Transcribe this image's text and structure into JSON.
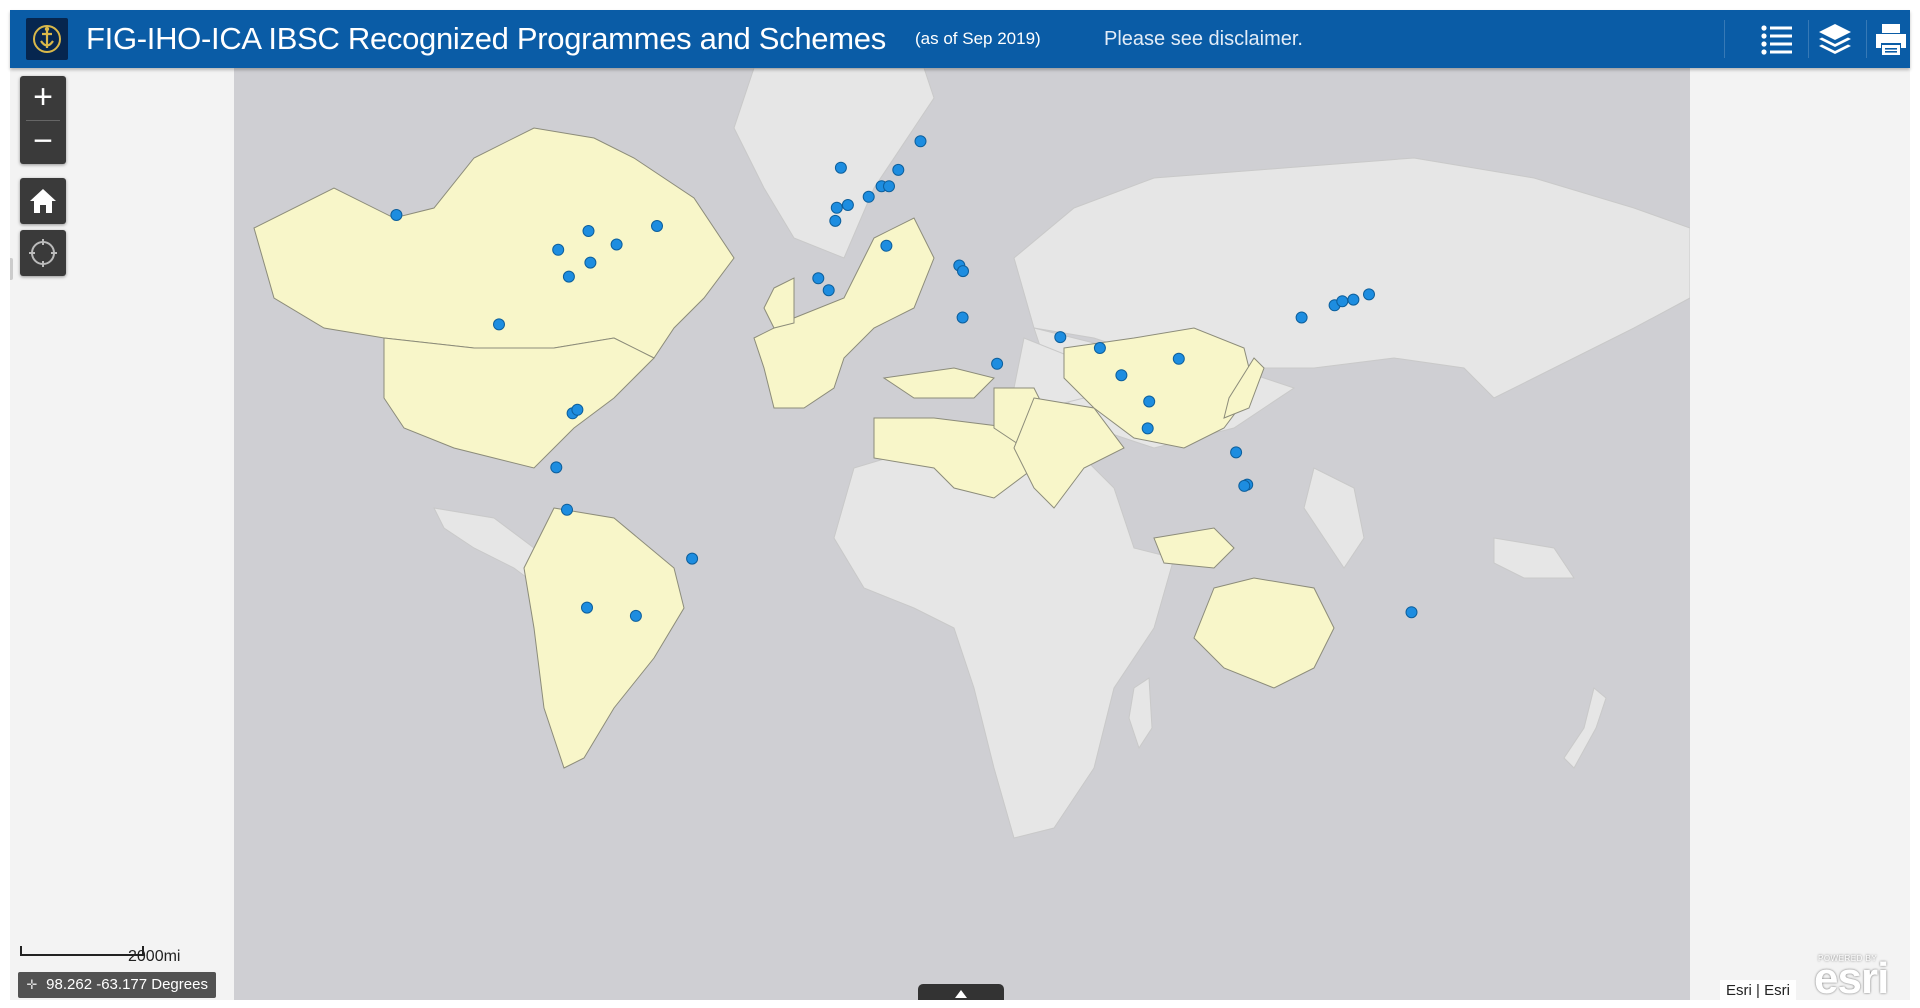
{
  "header": {
    "title": "FIG-IHO-ICA IBSC Recognized Programmes and Schemes",
    "subtitle": "(as of Sep 2019)",
    "disclaimer": "Please see disclaimer.",
    "icons": [
      "logo-emblem-icon",
      "legend-list-icon",
      "layers-icon",
      "print-icon"
    ]
  },
  "map_controls": {
    "zoom_in_label": "+",
    "zoom_out_label": "−",
    "home_icon": "home-icon",
    "locate_icon": "locate-icon"
  },
  "scale": {
    "label": "2000mi"
  },
  "coordinates": {
    "value": "98.262 -63.177 Degrees"
  },
  "attribution": {
    "text": "Esri | Esri"
  },
  "esri_logo": {
    "top": "POWERED BY",
    "word": "esri"
  },
  "colors": {
    "header_bg": "#0a5ca6",
    "ocean": "#cfcfd3",
    "land": "#e6e6e6",
    "highlighted_land": "#f8f6c9",
    "marker": "#1d8de0"
  },
  "map_points": [
    {
      "lon": -123.1,
      "lat": 49.3
    },
    {
      "lon": -79.4,
      "lat": 43.7
    },
    {
      "lon": -71.2,
      "lat": 46.8
    },
    {
      "lon": -63.6,
      "lat": 44.6
    },
    {
      "lon": -52.7,
      "lat": 47.6
    },
    {
      "lon": -76.5,
      "lat": 39.0
    },
    {
      "lon": -95.4,
      "lat": 29.8
    },
    {
      "lon": -70.7,
      "lat": 41.5
    },
    {
      "lon": -75.5,
      "lat": 10.4
    },
    {
      "lon": -74.2,
      "lat": 11.2
    },
    {
      "lon": -79.9,
      "lat": -2.2
    },
    {
      "lon": -77.0,
      "lat": -12.0
    },
    {
      "lon": -43.2,
      "lat": -22.9
    },
    {
      "lon": -71.6,
      "lat": -33.0
    },
    {
      "lon": -58.4,
      "lat": -34.6
    },
    {
      "lon": -3.0,
      "lat": 56.0
    },
    {
      "lon": -1.1,
      "lat": 50.8
    },
    {
      "lon": -4.1,
      "lat": 50.4
    },
    {
      "lon": 4.5,
      "lat": 52.0
    },
    {
      "lon": 8.0,
      "lat": 53.5
    },
    {
      "lon": 10.0,
      "lat": 53.5
    },
    {
      "lon": 12.5,
      "lat": 55.7
    },
    {
      "lon": 18.5,
      "lat": 59.3
    },
    {
      "lon": -4.5,
      "lat": 48.4
    },
    {
      "lon": -9.1,
      "lat": 38.7
    },
    {
      "lon": -6.3,
      "lat": 36.5
    },
    {
      "lon": 9.3,
      "lat": 44.4
    },
    {
      "lon": 29.0,
      "lat": 41.0
    },
    {
      "lon": 30.0,
      "lat": 40.0
    },
    {
      "lon": 29.9,
      "lat": 31.2
    },
    {
      "lon": 39.2,
      "lat": 21.5
    },
    {
      "lon": 56.3,
      "lat": 27.2
    },
    {
      "lon": 67.0,
      "lat": 24.9
    },
    {
      "lon": 72.8,
      "lat": 19.0
    },
    {
      "lon": 80.3,
      "lat": 13.1
    },
    {
      "lon": 79.9,
      "lat": 6.9
    },
    {
      "lon": 88.3,
      "lat": 22.6
    },
    {
      "lon": 103.8,
      "lat": 1.3
    },
    {
      "lon": 106.8,
      "lat": -6.2
    },
    {
      "lon": 106.0,
      "lat": -6.5
    },
    {
      "lon": 121.5,
      "lat": 31.2
    },
    {
      "lon": 130.4,
      "lat": 33.6
    },
    {
      "lon": 132.5,
      "lat": 34.4
    },
    {
      "lon": 135.5,
      "lat": 34.7
    },
    {
      "lon": 139.7,
      "lat": 35.7
    },
    {
      "lon": 151.2,
      "lat": -33.9
    }
  ]
}
